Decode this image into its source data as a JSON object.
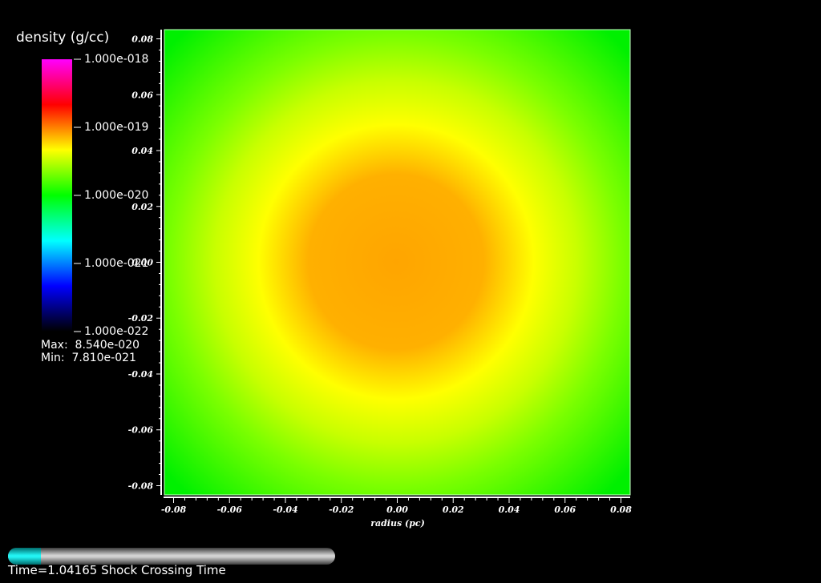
{
  "chart_data": {
    "type": "heatmap",
    "xlabel": "radius (pc)",
    "xlim": [
      -0.0833,
      0.0833
    ],
    "ylim": [
      -0.0833,
      0.0833
    ],
    "x_ticks": [
      "-0.08",
      "-0.06",
      "-0.04",
      "-0.02",
      "0.00",
      "0.02",
      "0.04",
      "0.06",
      "0.08"
    ],
    "y_ticks": [
      "0.08",
      "0.06",
      "0.04",
      "0.02",
      "0.00",
      "-0.02",
      "-0.04",
      "-0.06",
      "-0.08"
    ],
    "x_tick_values": [
      -0.08,
      -0.06,
      -0.04,
      -0.02,
      0.0,
      0.02,
      0.04,
      0.06,
      0.08
    ],
    "y_tick_values": [
      0.08,
      0.06,
      0.04,
      0.02,
      0.0,
      -0.02,
      -0.04,
      -0.06,
      -0.08
    ],
    "colorbar": {
      "title": "density (g/cc)",
      "scale": "log",
      "labels": [
        "1.000e-018",
        "1.000e-019",
        "1.000e-020",
        "1.000e-021",
        "1.000e-022"
      ],
      "colors_top_to_bottom": [
        "#ff00ff",
        "#ff0000",
        "#ffff00",
        "#00ff00",
        "#00ffff",
        "#0000ff",
        "#000000"
      ]
    },
    "max_label": "Max:  8.540e-020",
    "min_label": "Min:  7.810e-021",
    "field_colors": {
      "center": "#ffa500",
      "ring": "#ffff00",
      "edge": "#00f000"
    }
  },
  "progress": {
    "fraction": 0.1,
    "track_color": "#d4d4d4",
    "fill_color": "#22f4f4"
  },
  "time_label": "Time=1.04165 Shock Crossing Time"
}
